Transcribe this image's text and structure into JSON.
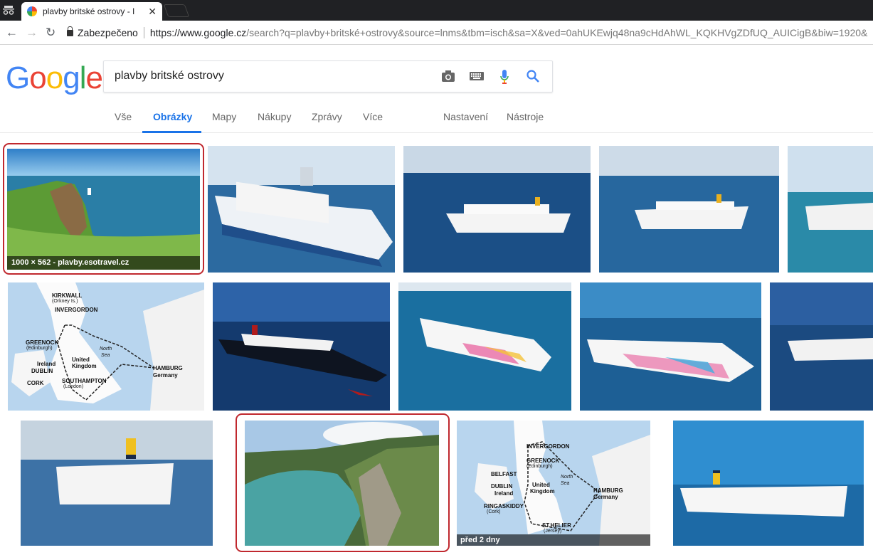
{
  "browser": {
    "tab_title": "plavby britské ostrovy - I",
    "secure_label": "Zabezpečeno",
    "url_main": "https://www.google.cz",
    "url_rest": "/search?q=plavby+britské+ostrovy&source=lnms&tbm=isch&sa=X&ved=0ahUKEwjq48na9cHdAhWL_KQKHVgZDfUQ_AUICigB&biw=1920&"
  },
  "logo": [
    "G",
    "o",
    "o",
    "g",
    "l",
    "e"
  ],
  "search": {
    "query": "plavby britské ostrovy"
  },
  "tabs": {
    "all": "Vše",
    "images": "Obrázky",
    "maps": "Mapy",
    "shopping": "Nákupy",
    "news": "Zprávy",
    "more": "Více",
    "settings": "Nastavení",
    "tools": "Nástroje"
  },
  "images": {
    "first_caption": "1000 × 562 - plavby.esotravel.cz",
    "map_caption": "před 2 dny",
    "map1": {
      "places": [
        "KIRKWALL",
        "(Orkney Is.)",
        "INVERGORDON",
        "GREENOCK",
        "(Edinburgh)",
        "United",
        "Kingdom",
        "North",
        "Sea",
        "Ireland",
        "DUBLIN",
        "CORK",
        "SOUTHAMPTON",
        "(London)",
        "HAMBURG",
        "Germany"
      ]
    },
    "map2": {
      "places": [
        "INVERGORDON",
        "GREENOCK",
        "(Edinburgh)",
        "BELFAST",
        "North",
        "Sea",
        "DUBLIN",
        "Ireland",
        "United",
        "Kingdom",
        "HAMBURG",
        "Germany",
        "RINGASKIDDY",
        "(Cork)",
        "ST.HELIER",
        "(Jersey)"
      ]
    }
  },
  "colors": {
    "accent": "#1a73e8",
    "highlight": "#c0282e",
    "g_blue": "#4285f4",
    "g_red": "#ea4335",
    "g_yellow": "#fbbc05",
    "g_green": "#34a853"
  }
}
